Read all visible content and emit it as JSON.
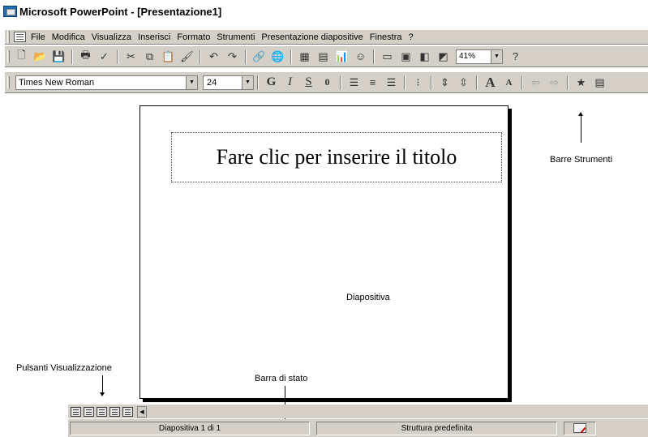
{
  "window": {
    "title": "Microsoft PowerPoint - [Presentazione1]"
  },
  "menu": {
    "items": [
      "File",
      "Modifica",
      "Visualizza",
      "Inserisci",
      "Formato",
      "Strumenti",
      "Presentazione diapositive",
      "Finestra",
      "?"
    ]
  },
  "standard_toolbar": {
    "zoom": "41%",
    "icons": [
      "new-icon",
      "open-icon",
      "save-icon",
      "print-icon",
      "spelling-icon",
      "cut-icon",
      "copy-icon",
      "paste-icon",
      "format-painter-icon",
      "undo-icon",
      "redo-icon",
      "hyperlink-icon",
      "web-icon",
      "table-icon",
      "worksheet-icon",
      "chart-icon",
      "clipart-icon",
      "new-slide-icon",
      "layout-icon",
      "background-icon",
      "apply-design-icon",
      "grayscale-icon",
      "help-icon"
    ]
  },
  "format_toolbar": {
    "font": "Times New Roman",
    "size": "24",
    "bold": "G",
    "italic": "I",
    "underline": "S",
    "shadow": "0",
    "increase_font": "A",
    "decrease_font": "A"
  },
  "slide": {
    "title_placeholder": "Fare clic per inserire il titolo",
    "body_label": "Diapositiva"
  },
  "annotations": {
    "toolbars": "Barre Strumenti",
    "view_buttons": "Pulsanti Visualizzazione",
    "status_bar": "Barra di stato"
  },
  "status": {
    "slide_count": "Diapositiva 1 di 1",
    "design": "Struttura predefinita"
  }
}
